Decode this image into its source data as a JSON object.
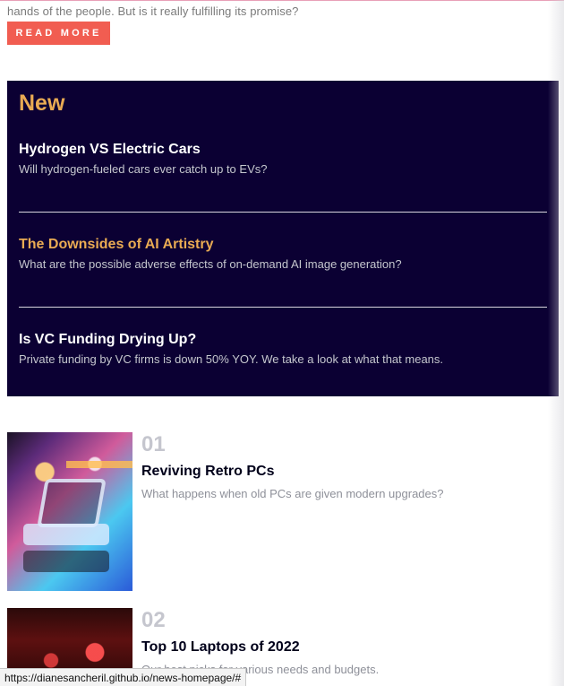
{
  "hero": {
    "cut_text": "hands of the people. But is it really fulfilling its promise?",
    "read_more_label": "READ MORE"
  },
  "new_section": {
    "title": "New",
    "items": [
      {
        "title": "Hydrogen VS Electric Cars",
        "description": "Will hydrogen-fueled cars ever catch up to EVs?"
      },
      {
        "title": "The Downsides of AI Artistry",
        "description": "What are the possible adverse effects of on-demand AI image generation?"
      },
      {
        "title": "Is VC Funding Drying Up?",
        "description": "Private funding by VC firms is down 50% YOY. We take a look at what that means."
      }
    ]
  },
  "featured_list": [
    {
      "number": "01",
      "title": "Reviving Retro PCs",
      "description": "What happens when old PCs are given modern upgrades?"
    },
    {
      "number": "02",
      "title": "Top 10 Laptops of 2022",
      "description": "Our best picks for various needs and budgets."
    }
  ],
  "browser_status": {
    "url": "https://dianesancheril.github.io/news-homepage/#"
  },
  "colors": {
    "accent_red": "#f15d51",
    "accent_orange": "#e9ab53",
    "dark_navy": "#0b0033",
    "heading_dark": "#00001a",
    "muted_gray": "#c5c6ce"
  }
}
